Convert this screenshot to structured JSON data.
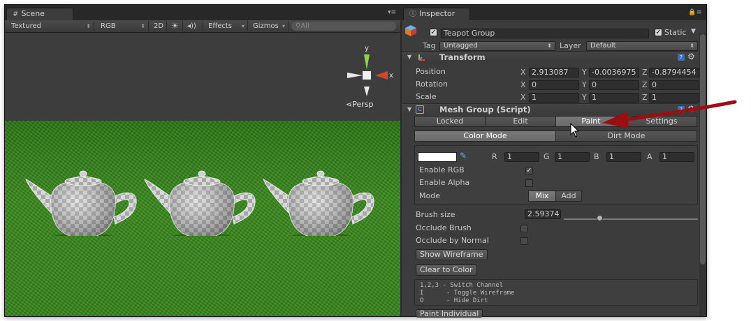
{
  "scene": {
    "tab_label": "Scene",
    "toolbar": {
      "render_mode": "Textured",
      "color_mode": "RGB",
      "two_d": "2D",
      "effects": "Effects",
      "gizmos": "Gizmos",
      "search_placeholder": "All"
    },
    "axes": {
      "y": "y",
      "x": "x"
    },
    "projection": "Persp"
  },
  "inspector": {
    "tab_label": "Inspector",
    "object": {
      "name": "Teapot Group",
      "active": true,
      "static_label": "Static",
      "static": true,
      "tag_label": "Tag",
      "tag_value": "Untagged",
      "layer_label": "Layer",
      "layer_value": "Default"
    },
    "transform": {
      "title": "Transform",
      "rows": [
        {
          "label": "Position",
          "x": "2.913087",
          "y": "-0.0036975",
          "z": "-0.8794454"
        },
        {
          "label": "Rotation",
          "x": "0",
          "y": "0",
          "z": "0"
        },
        {
          "label": "Scale",
          "x": "1",
          "y": "1",
          "z": "1"
        }
      ],
      "axis_x": "X",
      "axis_y": "Y",
      "axis_z": "Z"
    },
    "mesh_group": {
      "title": "Mesh Group (Script)",
      "tabs": [
        "Locked",
        "Edit",
        "Paint",
        "Settings"
      ],
      "active_tab": "Paint",
      "modes": [
        "Color Mode",
        "Dirt Mode"
      ],
      "active_mode": "Color Mode",
      "color": {
        "r_label": "R",
        "r": "1",
        "g_label": "G",
        "g": "1",
        "b_label": "B",
        "b": "1",
        "a_label": "A",
        "a": "1"
      },
      "enable_rgb_label": "Enable RGB",
      "enable_rgb": true,
      "enable_alpha_label": "Enable Alpha",
      "enable_alpha": false,
      "mode_label": "Mode",
      "mode_options": [
        "Mix",
        "Add"
      ],
      "brush_size_label": "Brush size",
      "brush_size": "2.59374",
      "occlude_brush_label": "Occlude Brush",
      "occlude_normal_label": "Occlude by Normal",
      "show_wireframe": "Show Wireframe",
      "clear_to_color": "Clear to Color",
      "help": [
        "1,2,3 - Switch Channel",
        "I      - Toggle Wireframe",
        "O      - Hide Dirt"
      ],
      "paint_individual": "Paint Individual"
    }
  },
  "colors": {
    "annotation_arrow": "#9b0f12",
    "grass": "#3b8a1f",
    "gizmo_y": "#8fd14f",
    "gizmo_x": "#d8442c"
  }
}
